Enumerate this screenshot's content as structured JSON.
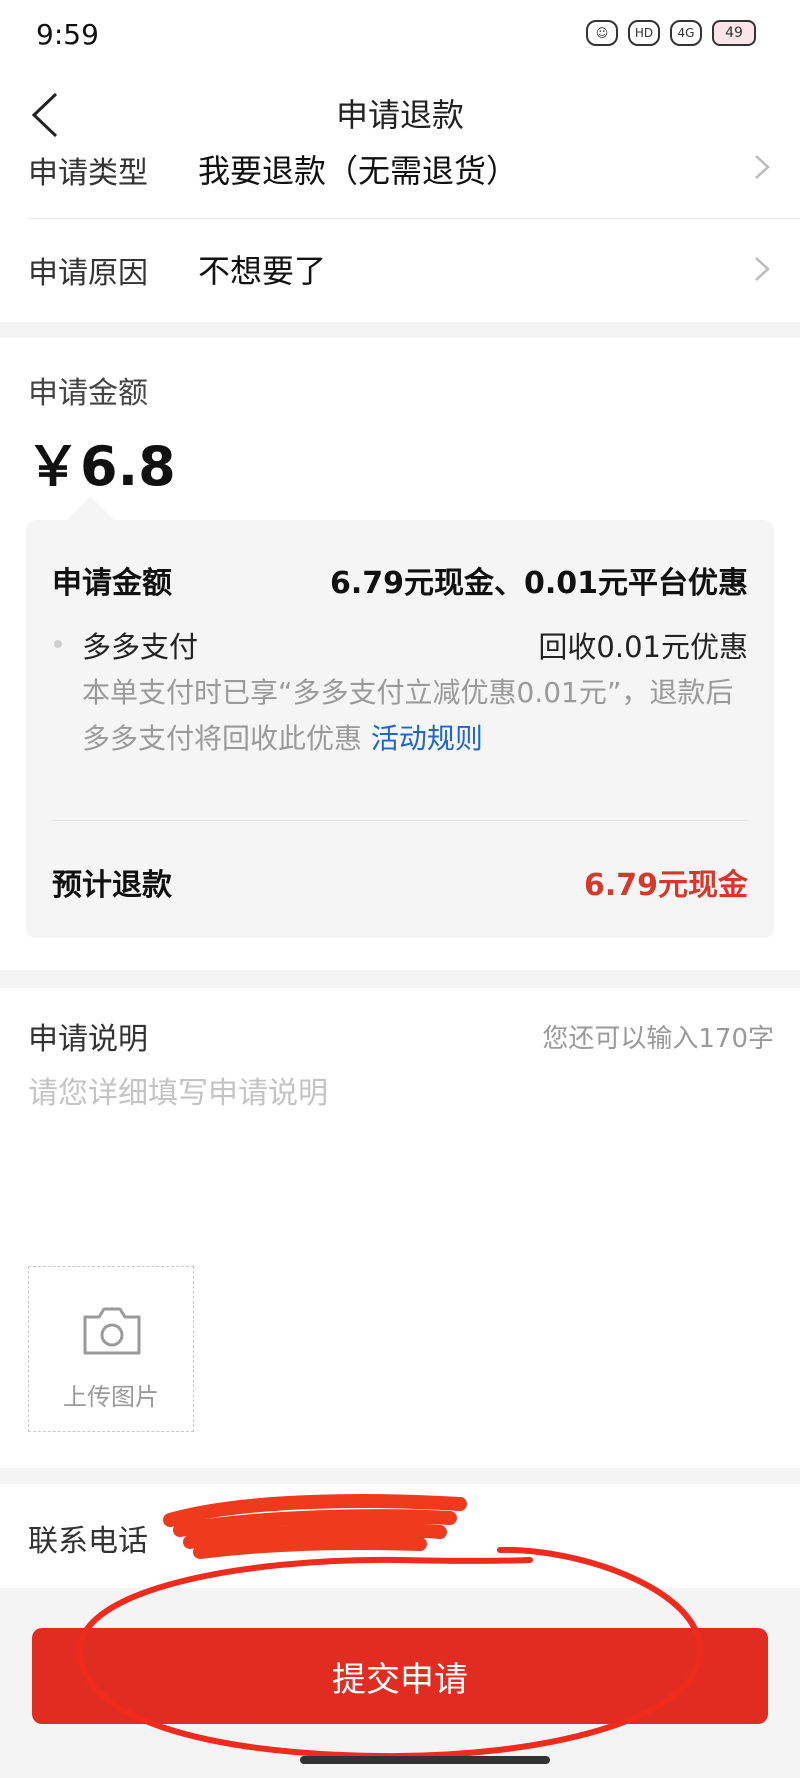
{
  "status_bar": {
    "time": "9:59",
    "hd_label": "HD",
    "network_label": "4G",
    "battery": "49"
  },
  "header": {
    "title": "申请退款"
  },
  "form": {
    "type_label": "申请类型",
    "type_value": "我要退款（无需退货）",
    "reason_label": "申请原因",
    "reason_value": "不想要了"
  },
  "amount": {
    "label": "申请金额",
    "value": "￥6.8",
    "detail": {
      "label": "申请金额",
      "value": "6.79元现金、0.01元平台优惠",
      "discount_title": "多多支付",
      "discount_value": "回收0.01元优惠",
      "discount_desc": "本单支付时已享“多多支付立减优惠0.01元”，退款后多多支付将回收此优惠",
      "rules_link": "活动规则",
      "estimate_label": "预计退款",
      "estimate_value": "6.79元现金"
    }
  },
  "explanation": {
    "label": "申请说明",
    "counter": "您还可以输入170字",
    "placeholder": "请您详细填写申请说明",
    "upload_label": "上传图片"
  },
  "contact": {
    "label": "联系电话"
  },
  "submit_label": "提交申请",
  "colors": {
    "accent": "#e12c22",
    "estimate": "#d33a2c",
    "link": "#1e66c8"
  }
}
